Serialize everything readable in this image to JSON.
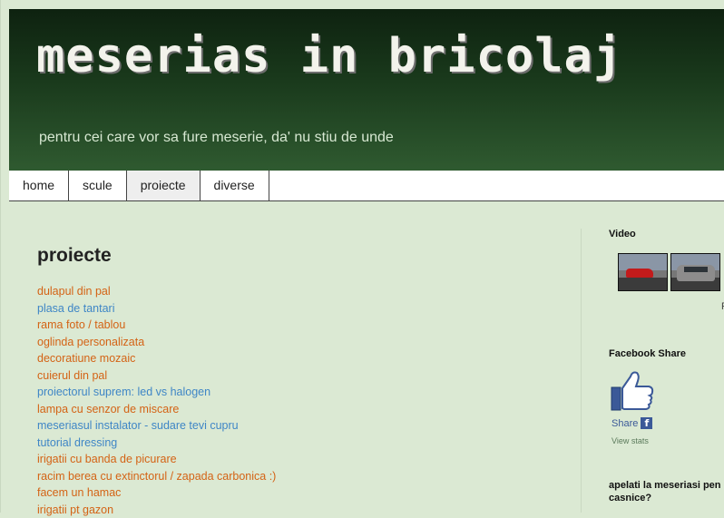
{
  "header": {
    "title": "meserias in bricolaj",
    "tagline": "pentru cei care vor sa fure meserie, da' nu stiu de unde"
  },
  "tabs": [
    {
      "label": "home",
      "active": false
    },
    {
      "label": "scule",
      "active": false
    },
    {
      "label": "proiecte",
      "active": true
    },
    {
      "label": "diverse",
      "active": false
    }
  ],
  "main": {
    "title": "proiecte",
    "links": [
      {
        "label": "dulapul din pal",
        "color": "#d46315"
      },
      {
        "label": "plasa de tantari",
        "color": "#3f86c6"
      },
      {
        "label": "rama foto / tablou",
        "color": "#d46315"
      },
      {
        "label": "oglinda personalizata",
        "color": "#d46315"
      },
      {
        "label": "decoratiune mozaic",
        "color": "#d46315"
      },
      {
        "label": "cuierul din pal",
        "color": "#d46315"
      },
      {
        "label": "proiectorul suprem: led vs halogen",
        "color": "#3f86c6"
      },
      {
        "label": "lampa cu senzor de miscare",
        "color": "#d46315"
      },
      {
        "label": "meseriasul instalator - sudare tevi cupru",
        "color": "#3f86c6"
      },
      {
        "label": "tutorial dressing",
        "color": "#3f86c6"
      },
      {
        "label": "irigatii cu banda de picurare",
        "color": "#d46315"
      },
      {
        "label": "racim berea cu extinctorul / zapada carbonica :)",
        "color": "#d46315"
      },
      {
        "label": "facem un hamac",
        "color": "#d46315"
      },
      {
        "label": "irigatii pt gazon",
        "color": "#d46315"
      }
    ]
  },
  "sidebar": {
    "video": {
      "title": "Video",
      "thumbs": [
        "video-thumb-red-car",
        "video-thumb-grey-car"
      ],
      "more": "P"
    },
    "facebook": {
      "title": "Facebook Share",
      "share_label": "Share",
      "fb_glyph": "f",
      "stats_label": "View stats"
    },
    "apelati": {
      "title": "apelati la meseriasi pen casnice?"
    }
  },
  "colors": {
    "background": "#dbe9d3",
    "link_orange": "#d46315",
    "link_blue": "#3f86c6",
    "facebook": "#3b5998"
  }
}
